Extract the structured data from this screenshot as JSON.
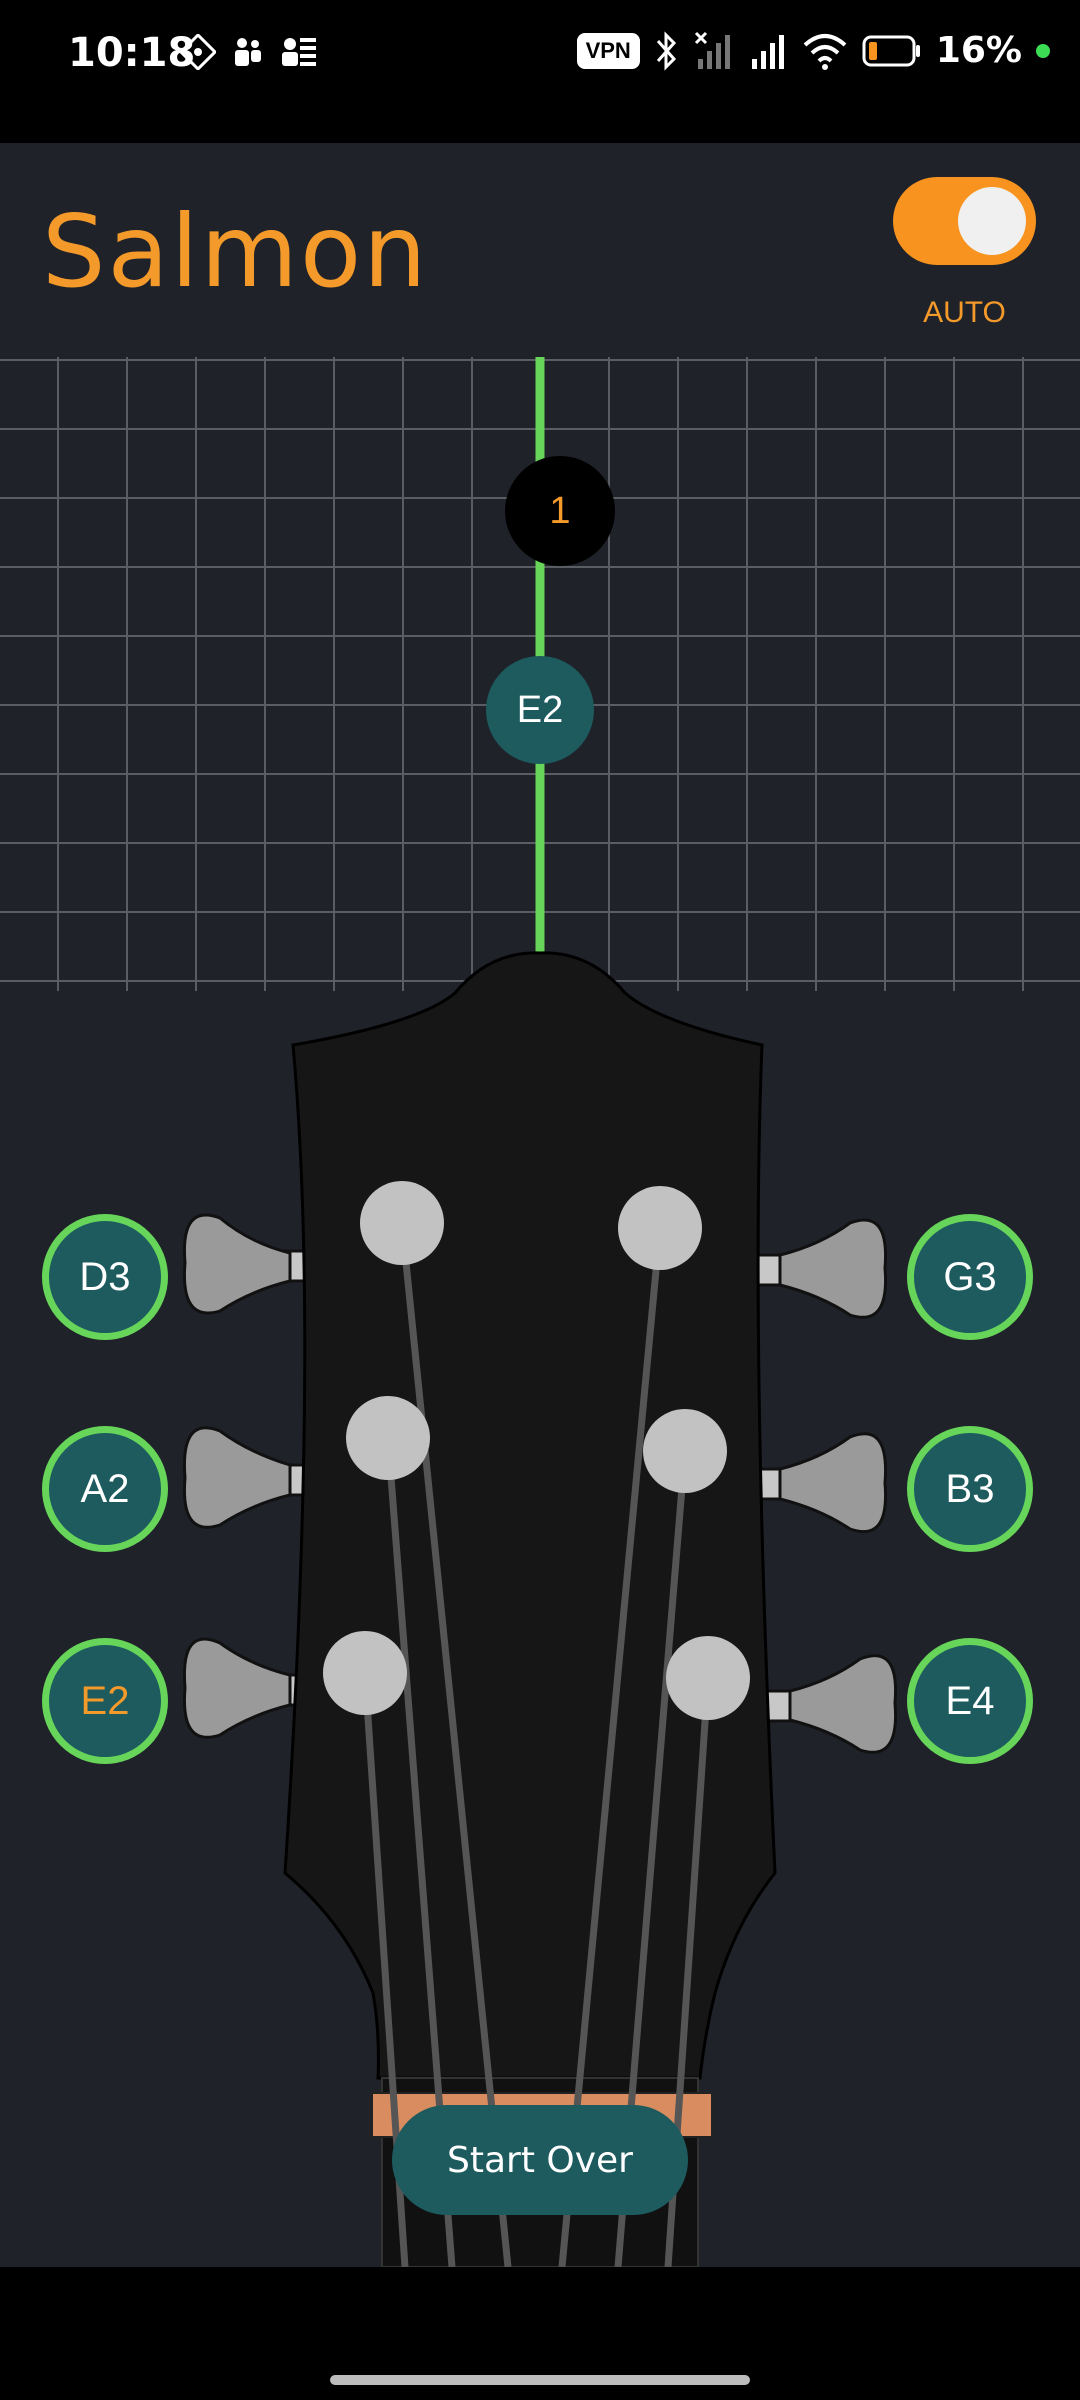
{
  "status_bar": {
    "time": "10:18",
    "vpn_label": "VPN",
    "battery_percent": "16%",
    "icons": [
      "app-icon-1",
      "teams-icon",
      "contacts-icon",
      "bluetooth-icon",
      "signal-off-icon",
      "signal-icon",
      "wifi-icon",
      "battery-icon"
    ]
  },
  "app": {
    "title": "Salmon",
    "toggle_on": true,
    "toggle_label": "AUTO",
    "counter": "1",
    "pointer_note": "E2",
    "strings_left": [
      "D3",
      "A2",
      "E2"
    ],
    "strings_right": [
      "G3",
      "B3",
      "E4"
    ],
    "active_string": "E2",
    "start_over_label": "Start Over",
    "colors": {
      "accent": "#f49a2a",
      "teal": "#1d5b5f",
      "green": "#67d45a",
      "background": "#1f2229"
    }
  }
}
